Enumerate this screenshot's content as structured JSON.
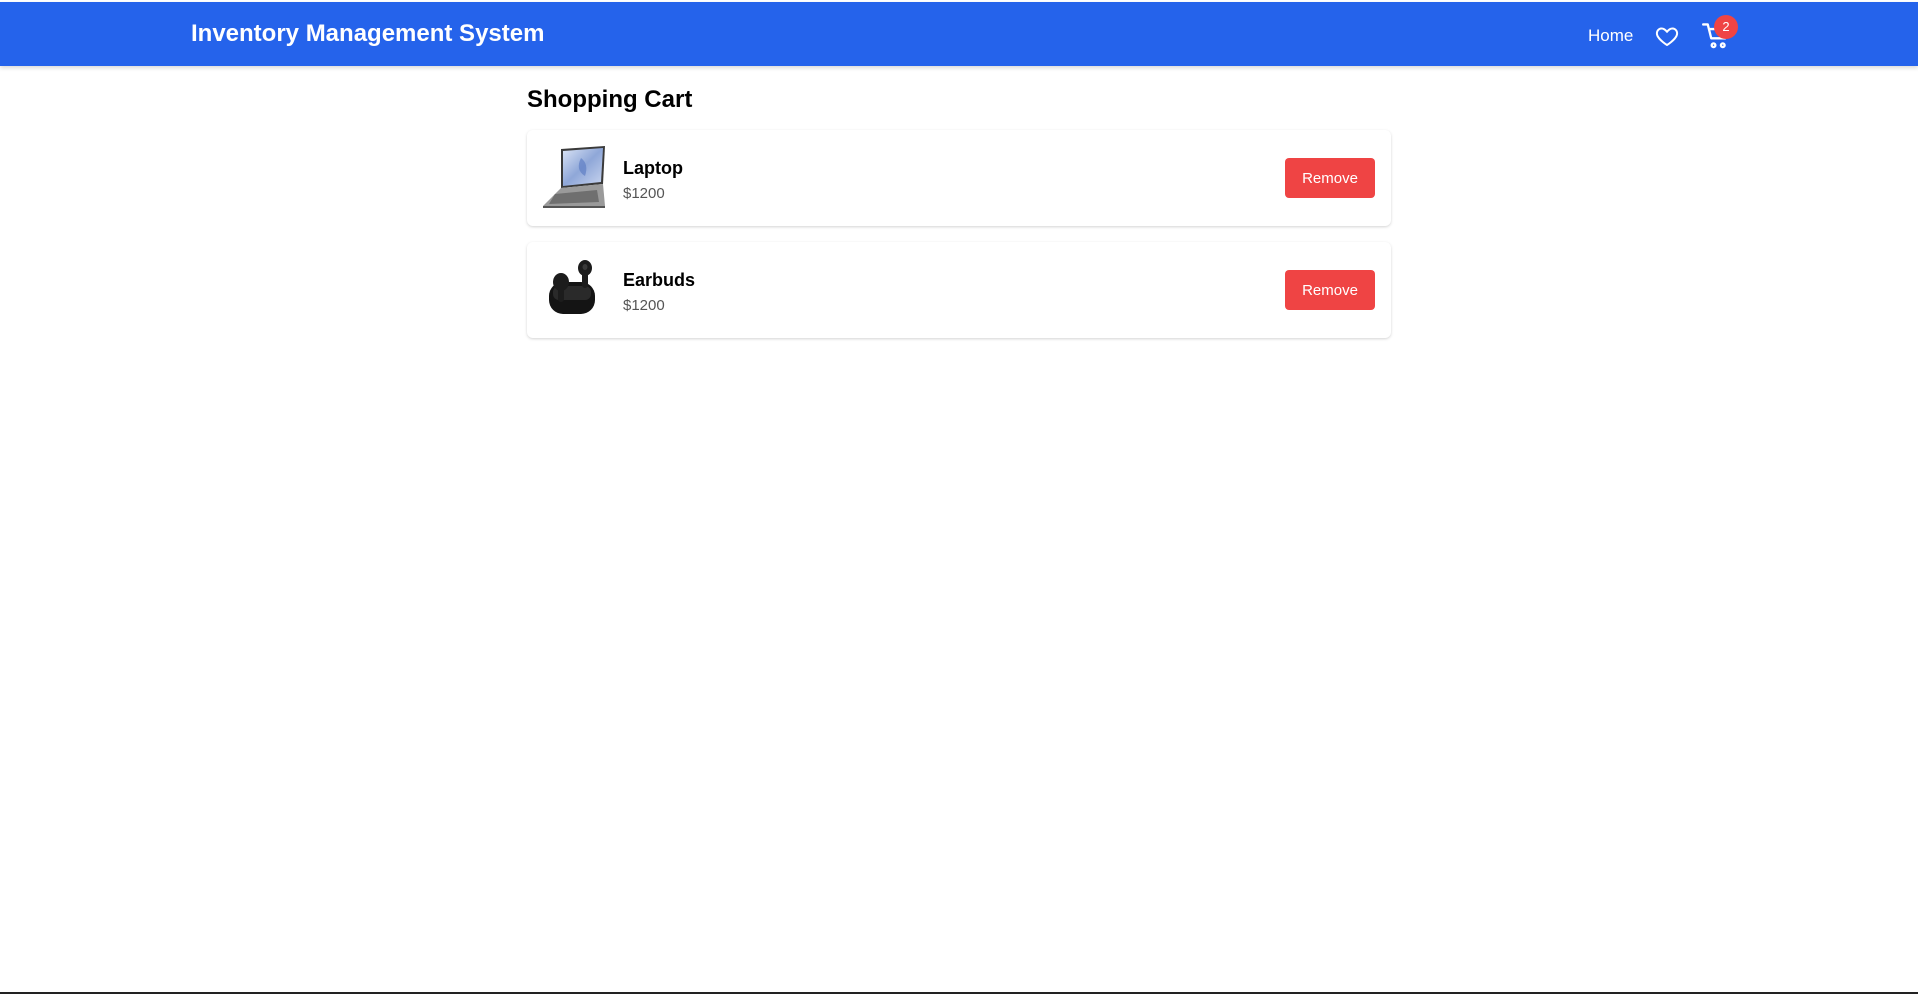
{
  "header": {
    "title": "Inventory Management System",
    "nav_home": "Home",
    "cart_count": "2",
    "accent_color": "#2563eb",
    "icons": [
      "heart-icon",
      "cart-icon"
    ]
  },
  "main": {
    "page_title": "Shopping Cart",
    "items": [
      {
        "name": "Laptop",
        "price": "$1200",
        "remove_label": "Remove",
        "image": "laptop-image"
      },
      {
        "name": "Earbuds",
        "price": "$1200",
        "remove_label": "Remove",
        "image": "earbuds-image"
      }
    ],
    "remove_color": "#ef4444"
  }
}
